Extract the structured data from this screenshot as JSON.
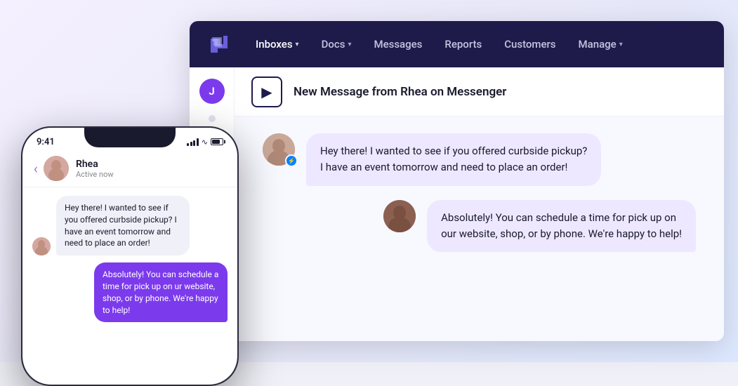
{
  "nav": {
    "logo_alt": "Chatwoot logo",
    "items": [
      {
        "label": "Inboxes",
        "has_dropdown": true,
        "active": false
      },
      {
        "label": "Docs",
        "has_dropdown": true,
        "active": false
      },
      {
        "label": "Messages",
        "has_dropdown": false,
        "active": false
      },
      {
        "label": "Reports",
        "has_dropdown": false,
        "active": false
      },
      {
        "label": "Customers",
        "has_dropdown": false,
        "active": false
      },
      {
        "label": "Manage",
        "has_dropdown": true,
        "active": false
      }
    ]
  },
  "notification": {
    "icon": "▷",
    "text": "New Message from Rhea on Messenger"
  },
  "sidebar": {
    "avatar_initial": "J",
    "avatar_color": "#7c3aed"
  },
  "phone": {
    "time": "9:41",
    "contact_name": "Rhea",
    "contact_status": "Active now",
    "messages": [
      {
        "type": "incoming",
        "text": "Hey there! I wanted to see if you offered curbside pickup? I have an event tomorrow and need to place an order!"
      },
      {
        "type": "outgoing",
        "text": "Absolutely! You can schedule a time for pick up on ur website, shop, or by phone. We're happy to help!"
      }
    ]
  },
  "desktop_chat": {
    "messages": [
      {
        "type": "incoming",
        "has_messenger_badge": true,
        "text": "Hey there! I wanted to see if you offered curbside pickup?\nI have an event tomorrow and need to place an order!"
      },
      {
        "type": "outgoing",
        "text": "Absolutely! You can schedule a time for pick up on\nour website, shop, or by phone. We're happy to help!"
      }
    ]
  }
}
